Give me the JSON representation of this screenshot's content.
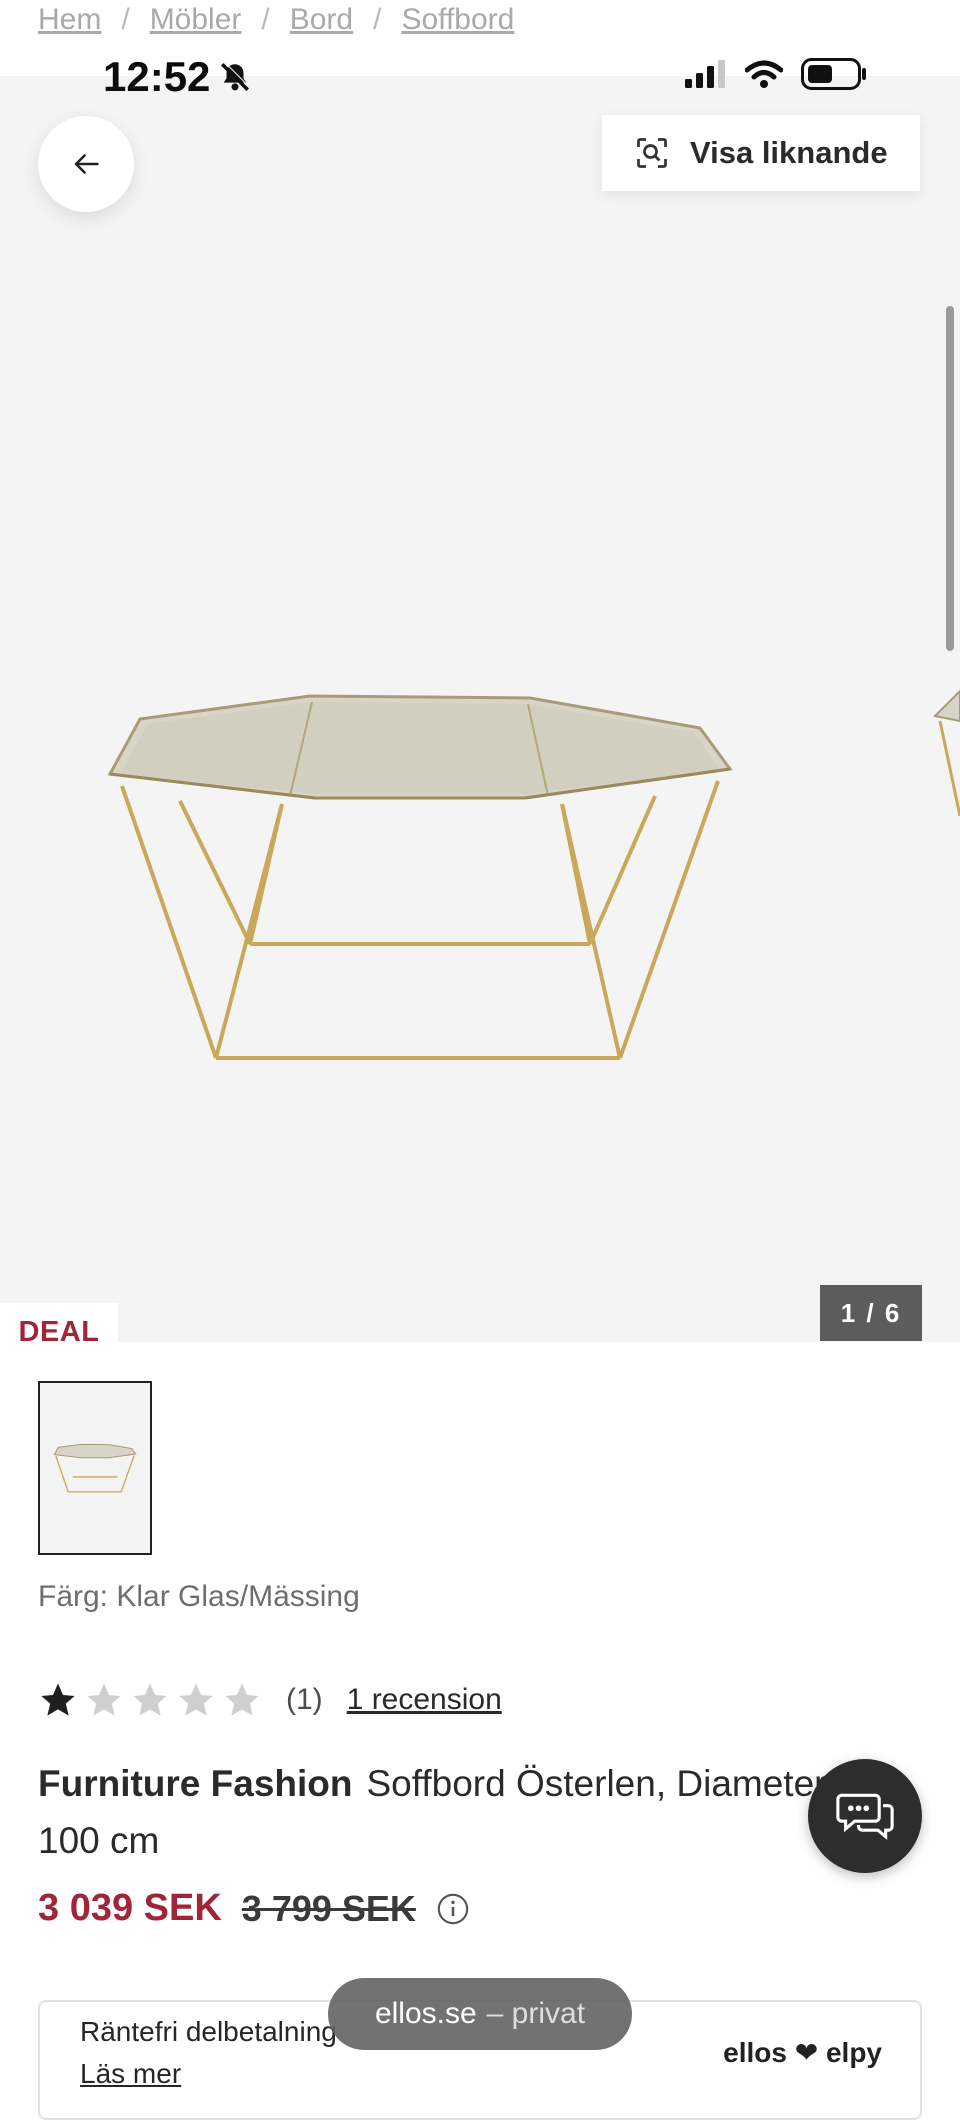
{
  "breadcrumb": [
    "Hem",
    "Möbler",
    "Bord",
    "Soffbord"
  ],
  "status_bar": {
    "time": "12:52"
  },
  "hero": {
    "similar_label": "Visa liknande",
    "deal_label": "DEAL",
    "counter": "1 / 6"
  },
  "product": {
    "color_label": "Färg:",
    "color_value": "Klar Glas/Mässing",
    "rating": 1,
    "rating_max": 5,
    "rating_count": "(1)",
    "reviews_label": "1 recension",
    "brand": "Furniture Fashion",
    "name": "Soffbord Österlen, Diameter 100 cm",
    "price_now": "3 039 SEK",
    "price_old": "3 799 SEK"
  },
  "finance": {
    "label": "Räntefri delbetalning",
    "link": "Läs mer",
    "brands": "ellos ❤ elpy"
  },
  "pill": {
    "host": "ellos.se",
    "suffix": "– privat"
  },
  "colors": {
    "accent": "#a1253a",
    "hero_bg": "#f4f4f4",
    "counter_bg": "#5c5c5c"
  }
}
